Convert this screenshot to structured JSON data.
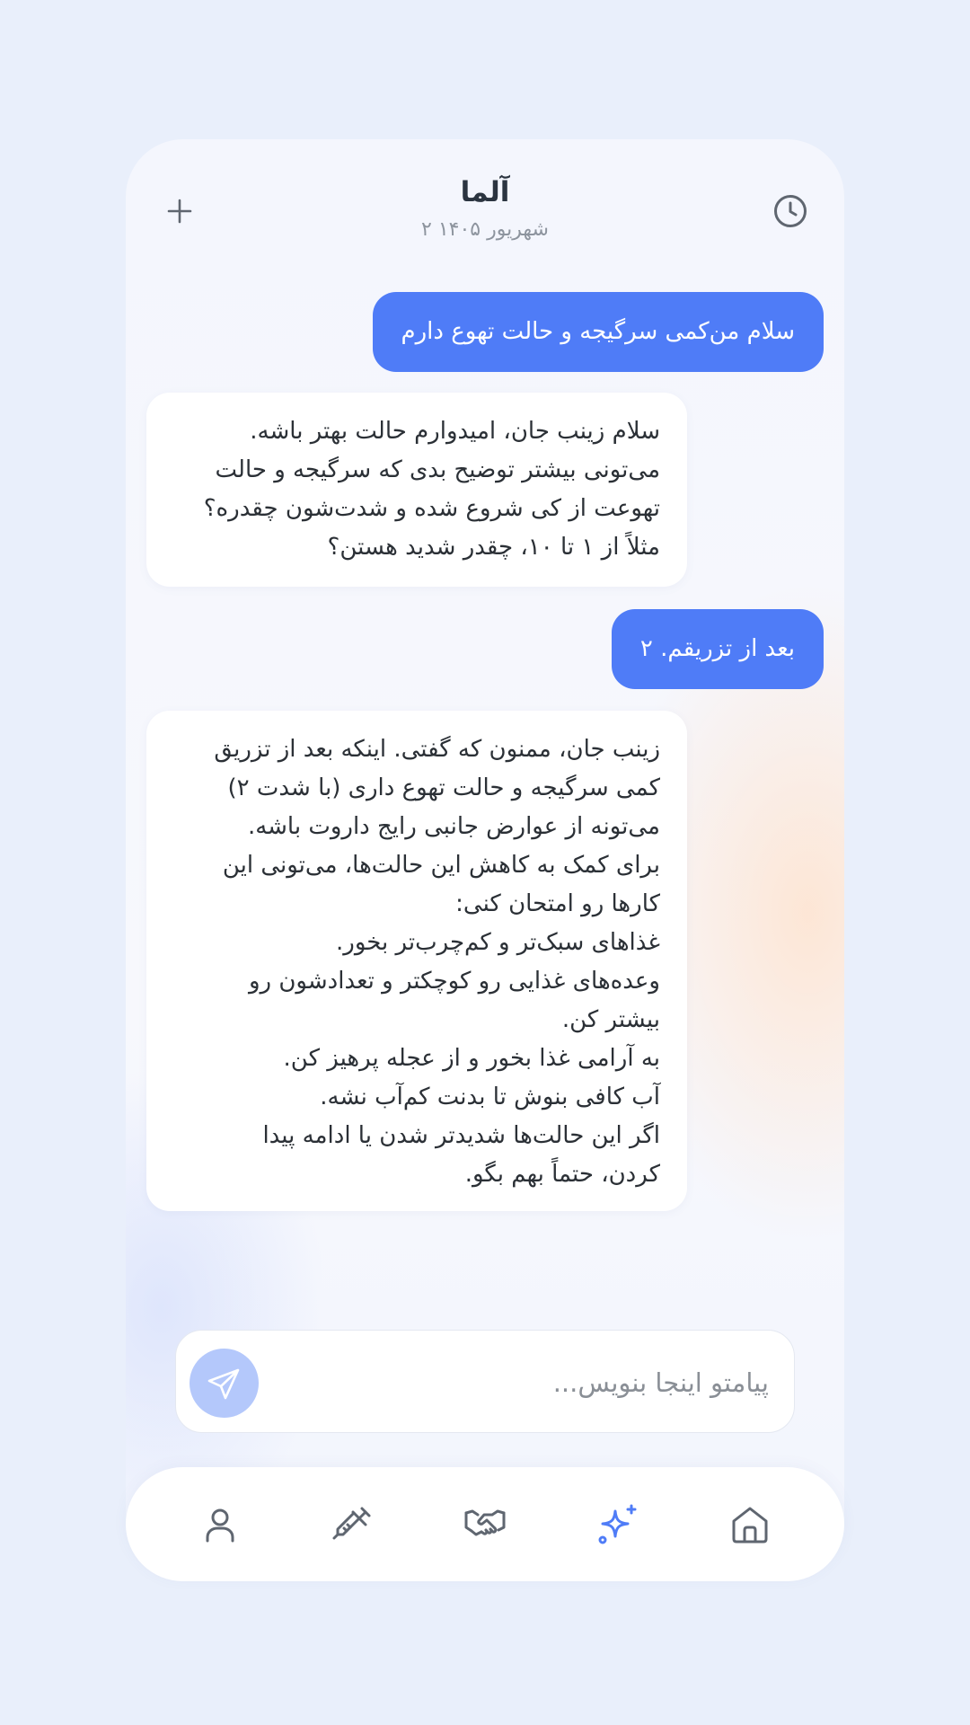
{
  "header": {
    "title": "آلما",
    "date": "۲ شهریور ۱۴۰۵"
  },
  "messages": [
    {
      "role": "user",
      "text": "سلام من‌کمی سرگیجه و حالت تهوع دارم"
    },
    {
      "role": "assistant",
      "text": "سلام زینب جان، امیدوارم حالت بهتر باشه.\nمی‌تونی بیشتر توضیح بدی که سرگیجه و حالت\nتهوعت از کی شروع شده و شدت‌شون چقدره؟\nمثلاً از ۱ تا ۱۰، چقدر شدید هستن؟"
    },
    {
      "role": "user",
      "text": "بعد از تزریقم. ۲"
    },
    {
      "role": "assistant",
      "text": "زینب جان، ممنون که گفتی. اینکه بعد از تزریق\nکمی سرگیجه و حالت تهوع داری (با شدت ۲)\nمی‌تونه از عوارض جانبی رایج داروت باشه.\nبرای کمک به کاهش این حالت‌ها، می‌تونی این\nکارها رو امتحان کنی:\nغذاهای سبک‌تر و کم‌چرب‌تر بخور.\nوعده‌های غذایی رو کوچکتر و تعدادشون رو\nبیشتر کن.\nبه آرامی غذا بخور و از عجله پرهیز کن.\nآب کافی بنوش تا بدنت کم‌آب نشه.\nاگر این حالت‌ها شدیدتر شدن یا ادامه پیدا\nکردن، حتماً بهم بگو."
    }
  ],
  "composer": {
    "placeholder": "پیامتو اینجا بنویس...",
    "value": ""
  },
  "icons": {
    "new_chat": "plus-icon",
    "history": "clock-icon",
    "send": "send-icon"
  },
  "nav": {
    "items": [
      {
        "name": "profile",
        "icon": "user-icon",
        "active": false
      },
      {
        "name": "injection",
        "icon": "syringe-icon",
        "active": false
      },
      {
        "name": "support",
        "icon": "handshake-icon",
        "active": false
      },
      {
        "name": "ai-assistant",
        "icon": "sparkles-icon",
        "active": true
      },
      {
        "name": "home",
        "icon": "home-icon",
        "active": false
      }
    ]
  },
  "colors": {
    "accent": "#4f7cf7",
    "send_button": "#b4c8fb",
    "icon_gray": "#5f6670",
    "background": "#e9effb"
  }
}
